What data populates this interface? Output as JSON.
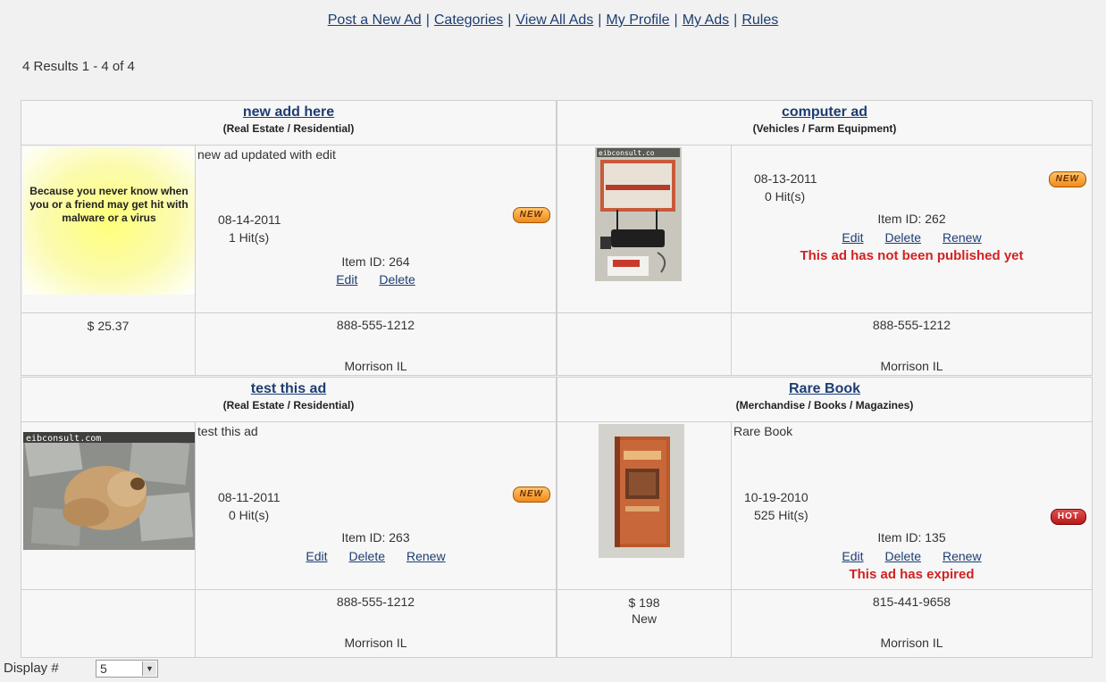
{
  "nav": {
    "post": "Post a New Ad",
    "categories": "Categories",
    "view_all": "View All Ads",
    "profile": "My Profile",
    "my_ads": "My Ads",
    "rules": "Rules",
    "separator": "|"
  },
  "results": "4 Results 1 - 4 of 4",
  "ads": [
    {
      "title": "new add here",
      "category": "(Real Estate / Residential)",
      "image_text": "Because you never know when you or a friend may get hit with malware or a virus",
      "description": "new ad  updated with edit",
      "date": "08-14-2011",
      "hits": "1 Hit(s)",
      "item_id": "Item ID: 264",
      "edit": "Edit",
      "delete": "Delete",
      "badge": "NEW",
      "price": "$ 25.37",
      "phone": "888-555-1212",
      "location": "Morrison IL"
    },
    {
      "title": "computer ad",
      "category": "(Vehicles / Farm Equipment)",
      "image_text": "eibconsult.co",
      "date": "08-13-2011",
      "hits": "0 Hit(s)",
      "item_id": "Item ID: 262",
      "edit": "Edit",
      "delete": "Delete",
      "renew": "Renew",
      "warning": "This ad has not been published yet",
      "badge": "NEW",
      "phone": "888-555-1212",
      "location": "Morrison IL"
    },
    {
      "title": "test this ad",
      "category": "(Real Estate / Residential)",
      "image_text": "eibconsult.com",
      "description": "test this ad",
      "date": "08-11-2011",
      "hits": "0 Hit(s)",
      "item_id": "Item ID: 263",
      "edit": "Edit",
      "delete": "Delete",
      "renew": "Renew",
      "badge": "NEW",
      "phone": "888-555-1212",
      "location": "Morrison IL"
    },
    {
      "title": "Rare Book",
      "category": "(Merchandise / Books / Magazines)",
      "description": "Rare Book",
      "date": "10-19-2010",
      "hits": "525 Hit(s)",
      "item_id": "Item ID: 135",
      "edit": "Edit",
      "delete": "Delete",
      "renew": "Renew",
      "warning": "This ad has expired",
      "badge": "HOT",
      "price": "$ 198",
      "condition": "New",
      "phone": "815-441-9658",
      "location": "Morrison IL"
    }
  ],
  "display": {
    "label": "Display #",
    "value": "5"
  },
  "colors": {
    "link": "#1d3d73",
    "warning": "#d32222",
    "badge_new": "#f08a1a",
    "badge_hot": "#b81818"
  },
  "icons": {
    "dropdown": "chevron-down-icon"
  }
}
